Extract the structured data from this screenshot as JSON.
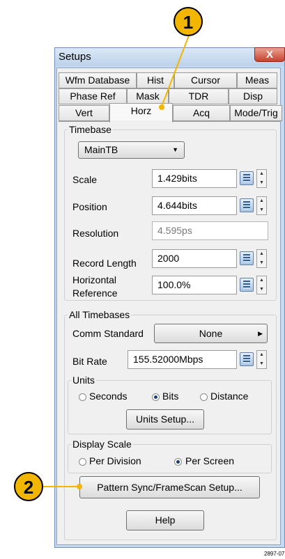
{
  "window": {
    "title": "Setups",
    "close": "X"
  },
  "tabs": {
    "row1": [
      "Wfm Database",
      "Hist",
      "Cursor",
      "Meas"
    ],
    "row2": [
      "Phase Ref",
      "Mask",
      "TDR",
      "Disp"
    ],
    "row3": [
      "Vert",
      "Horz",
      "Acq",
      "Mode/Trig"
    ],
    "selected": "Horz"
  },
  "timebase": {
    "group_label": "Timebase",
    "dropdown_value": "MainTB",
    "scale": {
      "label": "Scale",
      "value": "1.429bits"
    },
    "position": {
      "label": "Position",
      "value": "4.644bits"
    },
    "resolution": {
      "label": "Resolution",
      "value": "4.595ps"
    },
    "record_length": {
      "label": "Record Length",
      "value": "2000"
    },
    "horizontal_reference": {
      "label_line1": "Horizontal",
      "label_line2": "Reference",
      "value": "100.0%"
    }
  },
  "all_timebases": {
    "group_label": "All Timebases",
    "comm_standard": {
      "label": "Comm Standard",
      "value": "None"
    },
    "bit_rate": {
      "label": "Bit Rate",
      "value": "155.52000Mbps"
    }
  },
  "units": {
    "group_label": "Units",
    "options": [
      "Seconds",
      "Bits",
      "Distance"
    ],
    "selected": "Bits",
    "setup_button": "Units Setup..."
  },
  "display_scale": {
    "group_label": "Display Scale",
    "options": [
      "Per Division",
      "Per Screen"
    ],
    "selected": "Per Screen"
  },
  "buttons": {
    "pattern_sync": "Pattern Sync/FrameScan Setup...",
    "help": "Help"
  },
  "callouts": {
    "one": "1",
    "two": "2"
  },
  "figure_id": "2897-07",
  "colors": {
    "callout": "#f2b600",
    "title_bar": "#c5d9f0",
    "close_button": "#c7432e"
  }
}
